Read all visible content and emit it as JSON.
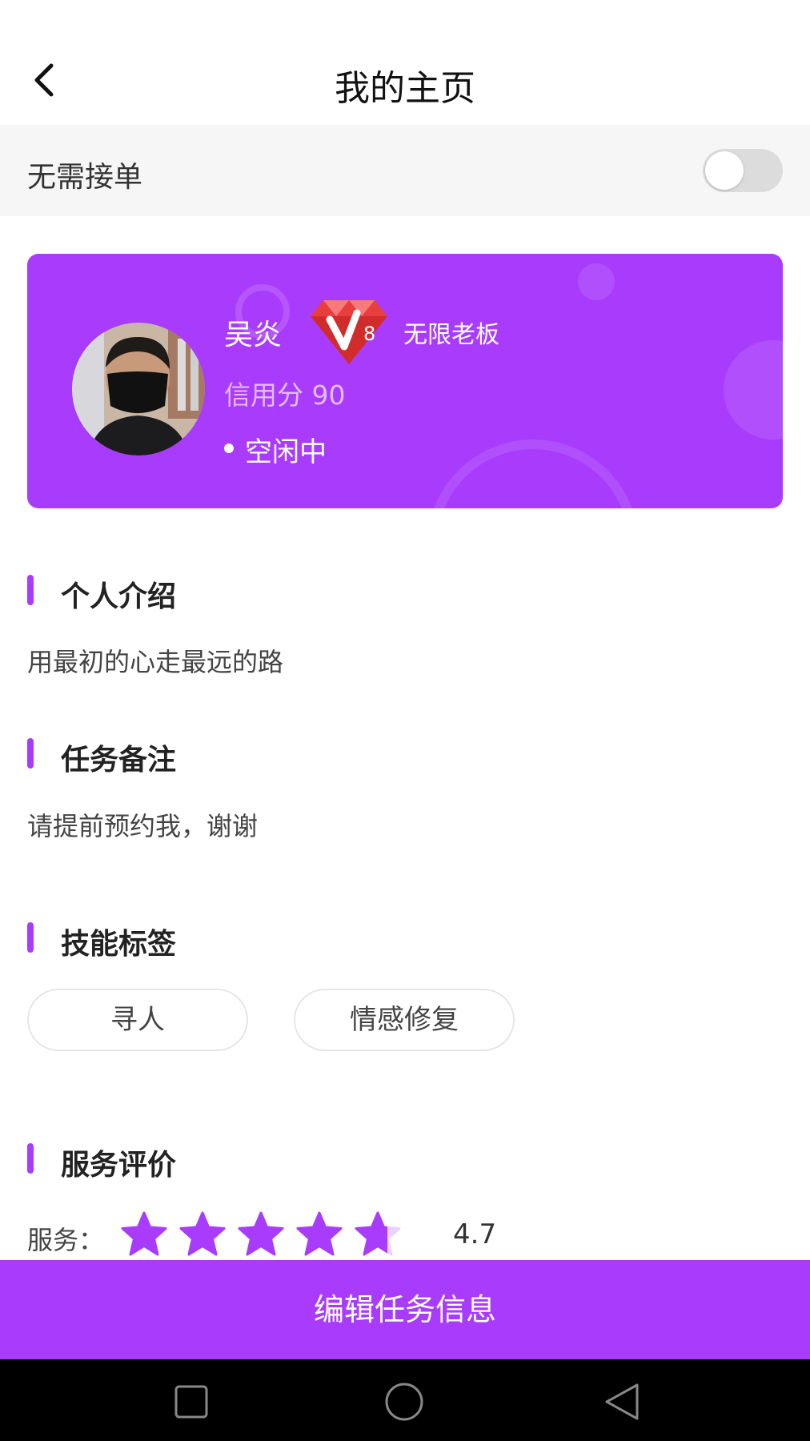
{
  "header": {
    "title": "我的主页",
    "back_icon": "back-arrow-icon"
  },
  "order_toggle": {
    "label": "无需接单",
    "on": false
  },
  "profile": {
    "name": "吴炎",
    "vip_level": "8",
    "vip_title": "无限老板",
    "credit": "信用分 90",
    "status": "空闲中",
    "card_color": "#a93cfc"
  },
  "sections": {
    "intro": {
      "title": "个人介绍",
      "text": "用最初的心走最远的路"
    },
    "notes": {
      "title": "任务备注",
      "text": "请提前预约我，谢谢"
    },
    "skills": {
      "title": "技能标签",
      "tags": [
        "寻人",
        "情感修复"
      ]
    },
    "reviews": {
      "title": "服务评价",
      "items": [
        {
          "label": "服务：",
          "value": "4.7",
          "rating": 4.7,
          "max": 5
        }
      ]
    }
  },
  "actions": {
    "edit_label": "编辑任务信息"
  },
  "system_nav": {
    "icons": [
      "recent-apps-icon",
      "home-icon",
      "back-triangle-icon"
    ]
  },
  "colors": {
    "accent": "#a93cfc",
    "star_empty": "#e9d2ff"
  }
}
